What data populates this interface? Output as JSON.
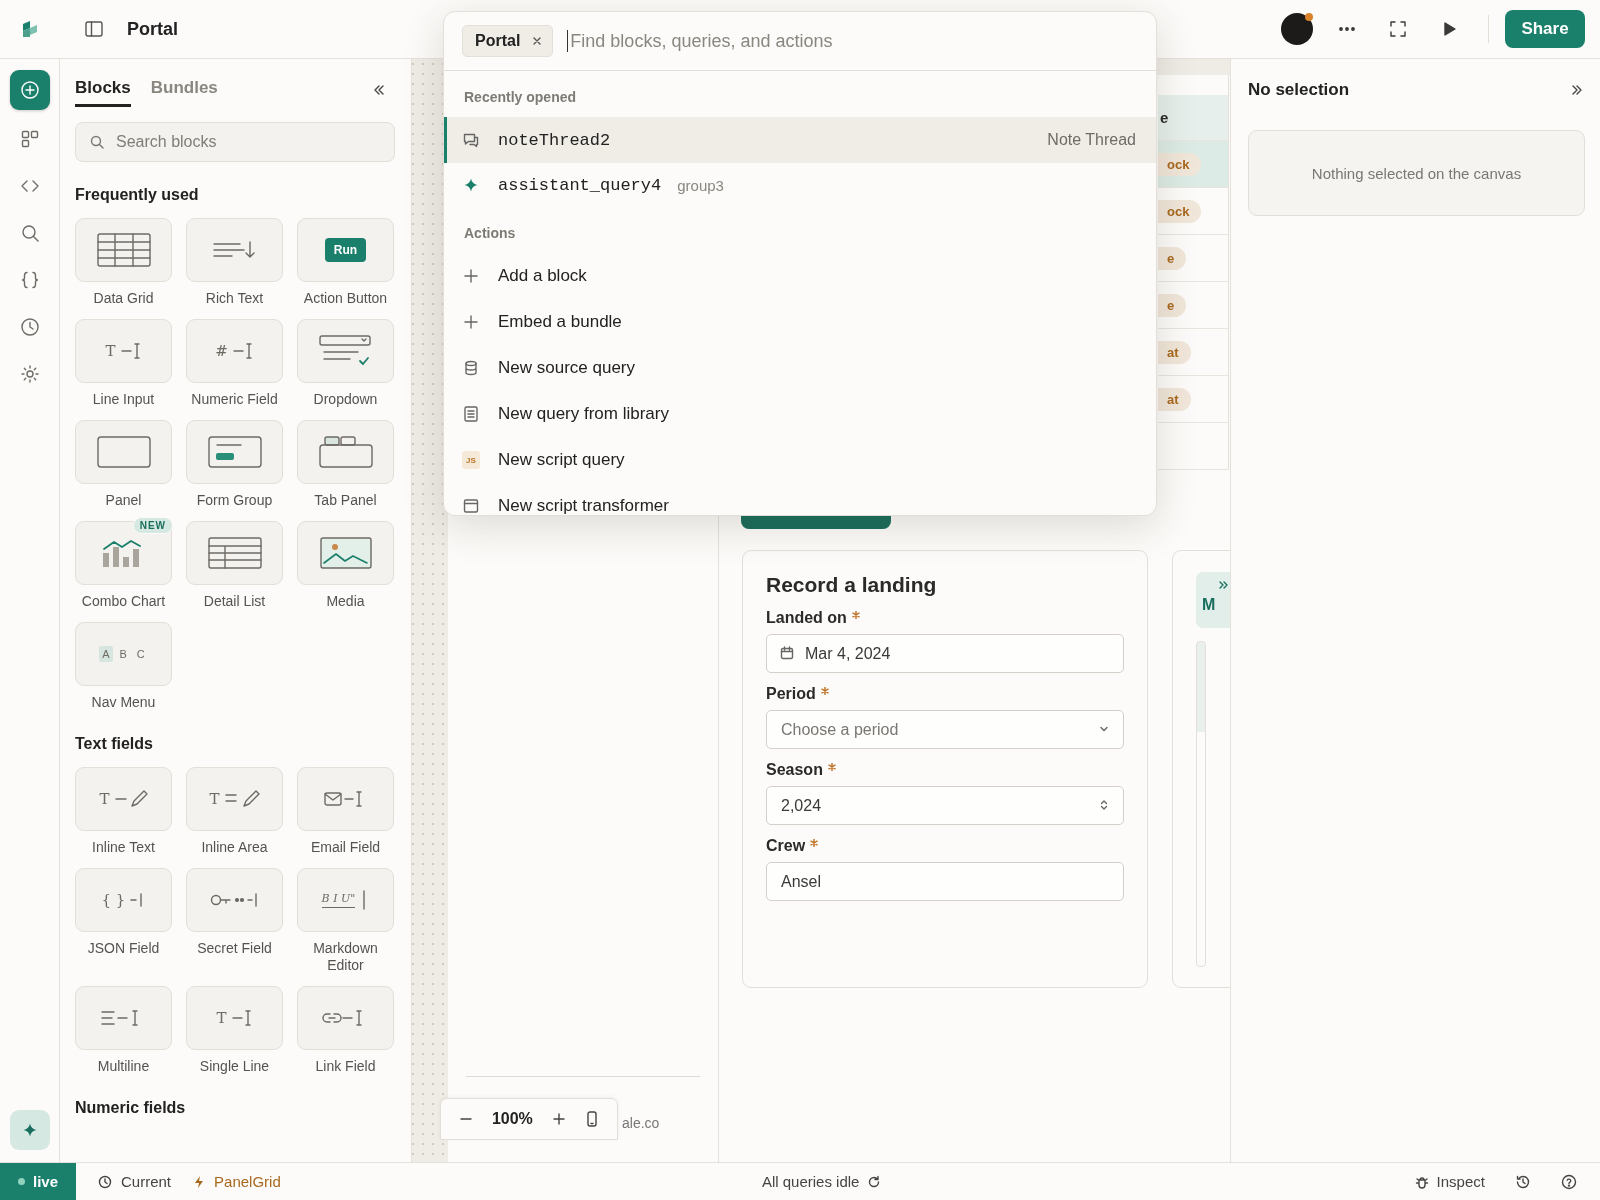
{
  "app": {
    "title": "Portal",
    "share_label": "Share"
  },
  "rail": [
    {
      "kind": "add",
      "selected": true
    },
    {
      "kind": "blocks",
      "selected": false
    },
    {
      "kind": "code",
      "selected": false
    },
    {
      "kind": "search",
      "selected": false
    },
    {
      "kind": "braces",
      "selected": false
    },
    {
      "kind": "history",
      "selected": false
    },
    {
      "kind": "settings",
      "selected": false
    }
  ],
  "blocks_panel": {
    "tabs": [
      {
        "label": "Blocks",
        "selected": true
      },
      {
        "label": "Bundles",
        "selected": false
      }
    ],
    "search": {
      "placeholder": "Search blocks"
    },
    "sections": [
      {
        "title": "Frequently used",
        "blocks": [
          {
            "label": "Data Grid",
            "kind": "grid"
          },
          {
            "label": "Rich Text",
            "kind": "richtext"
          },
          {
            "label": "Action Button",
            "kind": "run",
            "icon_text": "Run"
          },
          {
            "label": "Line Input",
            "kind": "input",
            "icon_text": "T"
          },
          {
            "label": "Numeric Field",
            "kind": "input",
            "icon_text": "#"
          },
          {
            "label": "Dropdown",
            "kind": "dropdown"
          },
          {
            "label": "Panel",
            "kind": "panel"
          },
          {
            "label": "Form Group",
            "kind": "formgroup"
          },
          {
            "label": "Tab Panel",
            "kind": "tabpanel"
          },
          {
            "label": "Combo Chart",
            "kind": "chart",
            "badge": "NEW"
          },
          {
            "label": "Detail List",
            "kind": "detaillist"
          },
          {
            "label": "Media",
            "kind": "media"
          },
          {
            "label": "Nav Menu",
            "kind": "nav",
            "letters": [
              {
                "text": "A",
                "selected": true
              },
              {
                "text": "B",
                "selected": false
              },
              {
                "text": "C",
                "selected": false
              }
            ]
          }
        ]
      },
      {
        "title": "Text fields",
        "blocks": [
          {
            "label": "Inline Text",
            "kind": "inline",
            "icon_text": "T"
          },
          {
            "label": "Inline Area",
            "kind": "inlinearea",
            "icon_text": "T"
          },
          {
            "label": "Email Field",
            "kind": "email"
          },
          {
            "label": "JSON Field",
            "kind": "json",
            "icon_text": "{ }"
          },
          {
            "label": "Secret Field",
            "kind": "secret"
          },
          {
            "label": "Markdown Editor",
            "kind": "markdown",
            "icon_text": "B I U\""
          },
          {
            "label": "Multiline",
            "kind": "multiline"
          },
          {
            "label": "Single Line",
            "kind": "input",
            "icon_text": "T"
          },
          {
            "label": "Link Field",
            "kind": "link"
          }
        ]
      },
      {
        "title": "Numeric fields"
      }
    ]
  },
  "palette": {
    "chip": "Portal",
    "placeholder": "Find blocks, queries, and actions",
    "recent_title": "Recently opened",
    "recent": [
      {
        "name": "noteThread2",
        "meta": "Note Thread",
        "kind": "block",
        "selected": true
      },
      {
        "name": "assistant_query4",
        "meta": "group3",
        "kind": "query",
        "selected": false
      }
    ],
    "actions_title": "Actions",
    "actions": [
      {
        "label": "Add a block",
        "kind": "add"
      },
      {
        "label": "Embed a bundle",
        "kind": "add"
      },
      {
        "label": "New source query",
        "kind": "source"
      },
      {
        "label": "New query from library",
        "kind": "library"
      },
      {
        "label": "New script query",
        "kind": "script",
        "badge": "JS"
      },
      {
        "label": "New script transformer",
        "kind": "transformer"
      }
    ]
  },
  "canvas": {
    "footer_text": "ale.co",
    "table": {
      "header": "e",
      "rows": [
        {
          "tag": "ock",
          "selected": true
        },
        {
          "tag": "ock",
          "selected": false
        },
        {
          "tag": "e",
          "selected": false
        },
        {
          "tag": "e",
          "selected": false
        },
        {
          "tag": "at",
          "selected": false
        },
        {
          "tag": "at",
          "selected": false
        }
      ]
    },
    "form": {
      "title": "Record a landing",
      "fields": [
        {
          "label": "Landed on",
          "required": true,
          "kind": "date",
          "value": "Mar 4, 2024"
        },
        {
          "label": "Period",
          "required": true,
          "kind": "select",
          "placeholder": "Choose a period"
        },
        {
          "label": "Season",
          "required": true,
          "kind": "number",
          "value": "2,024"
        },
        {
          "label": "Crew",
          "required": true,
          "kind": "text",
          "value": "Ansel"
        }
      ]
    },
    "side_tag": "M",
    "zoom": "100%"
  },
  "inspector": {
    "title": "No selection",
    "empty_text": "Nothing selected on the canvas"
  },
  "status_bar": {
    "env": "live",
    "version": "Current",
    "branch": "PanelGrid",
    "queries": "All queries idle",
    "inspect": "Inspect"
  }
}
